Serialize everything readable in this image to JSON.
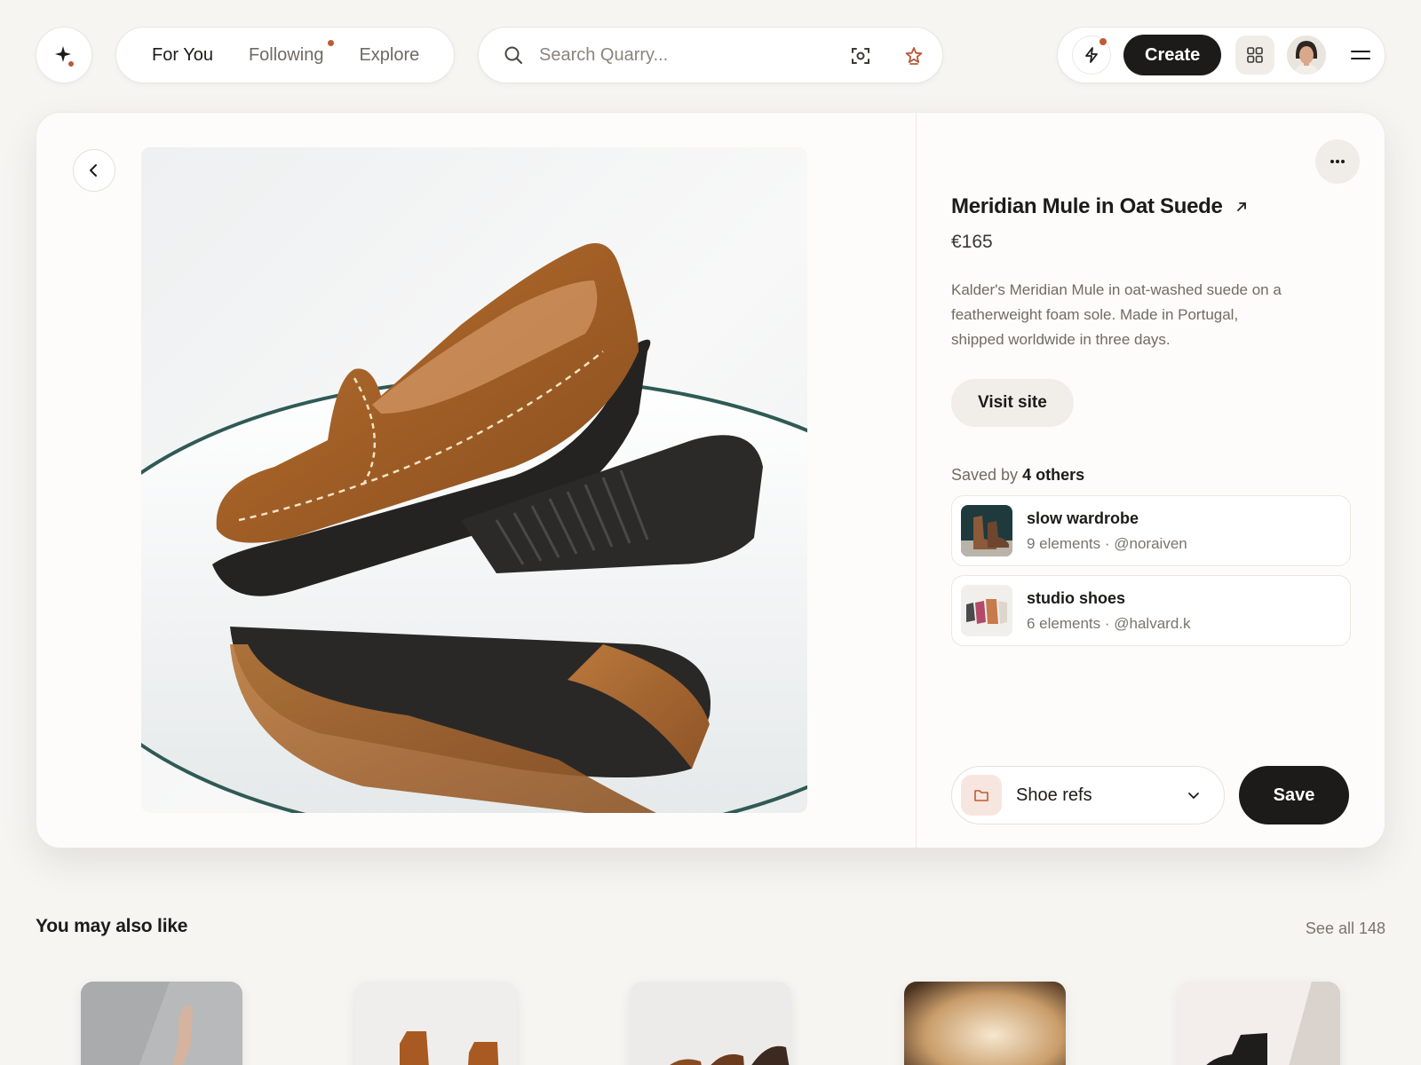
{
  "nav": {
    "tabs": [
      {
        "label": "For You"
      },
      {
        "label": "Following"
      },
      {
        "label": "Explore"
      }
    ]
  },
  "search": {
    "placeholder": "Search Quarry..."
  },
  "header": {
    "create_label": "Create"
  },
  "product": {
    "title": "Meridian Mule in Oat Suede",
    "price": "€165",
    "description": "Kalder's Meridian Mule in oat-washed suede on a featherweight foam sole. Made in Portugal, shipped worldwide in three days.",
    "visit_label": "Visit site",
    "saved_prefix": "Saved by",
    "saved_count": "4 others"
  },
  "boards": [
    {
      "name": "slow wardrobe",
      "meta": "9 elements · @noraiven"
    },
    {
      "name": "studio shoes",
      "meta": "6 elements · @halvard.k"
    }
  ],
  "save_bar": {
    "board_label": "Shoe refs",
    "save_label": "Save"
  },
  "recommendations": {
    "title": "You may also like",
    "see_all": "See all 148"
  },
  "colors": {
    "accent": "#c05a35",
    "primary_dark": "#1c1b19",
    "page_bg": "#f6f5f2",
    "suede": "#a8642a"
  },
  "icons": [
    "sparkle-icon",
    "search-icon",
    "visual-search-icon",
    "star-icon",
    "bolt-icon",
    "grid-icon",
    "menu-icon",
    "chevron-left-icon",
    "more-icon",
    "external-link-icon",
    "folder-icon",
    "chevron-down-icon"
  ]
}
